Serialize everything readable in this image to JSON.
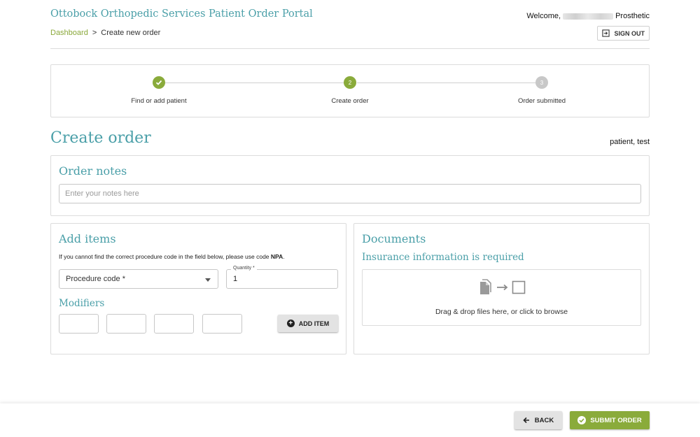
{
  "header": {
    "app_title": "Ottobock Orthopedic Services Patient Order Portal",
    "welcome_prefix": "Welcome,",
    "welcome_suffix": "Prosthetic",
    "signout_label": "SIGN OUT",
    "signout_icon": "exit-to-app-icon"
  },
  "breadcrumb": {
    "home": "Dashboard",
    "separator": ">",
    "current": "Create new order"
  },
  "stepper": {
    "steps": [
      {
        "label": "Find or add patient",
        "marker": "",
        "state": "completed"
      },
      {
        "label": "Create order",
        "marker": "2",
        "state": "active"
      },
      {
        "label": "Order submitted",
        "marker": "3",
        "state": "pending"
      }
    ]
  },
  "page": {
    "title": "Create order",
    "patient": "patient, test"
  },
  "order_notes": {
    "title": "Order notes",
    "placeholder": "Enter your notes here",
    "value": ""
  },
  "add_items": {
    "title": "Add items",
    "hint_text": "If you cannot find the correct procedure code in the field below, please use code ",
    "hint_code": "NPA",
    "hint_end": ".",
    "procedure_label": "Procedure code *",
    "quantity_label": "Quantity *",
    "quantity_value": "1",
    "modifiers_title": "Modifiers",
    "add_item_label": "ADD ITEM"
  },
  "documents": {
    "title": "Documents",
    "insurance_title": "Insurance information is required",
    "dropzone_text": "Drag & drop files here, or click to browse"
  },
  "footer": {
    "back_label": "BACK",
    "submit_label": "SUBMIT ORDER"
  },
  "colors": {
    "accent_teal": "#4a9fa8",
    "accent_green": "#8aab3b",
    "pending_grey": "#c8c8c8"
  }
}
